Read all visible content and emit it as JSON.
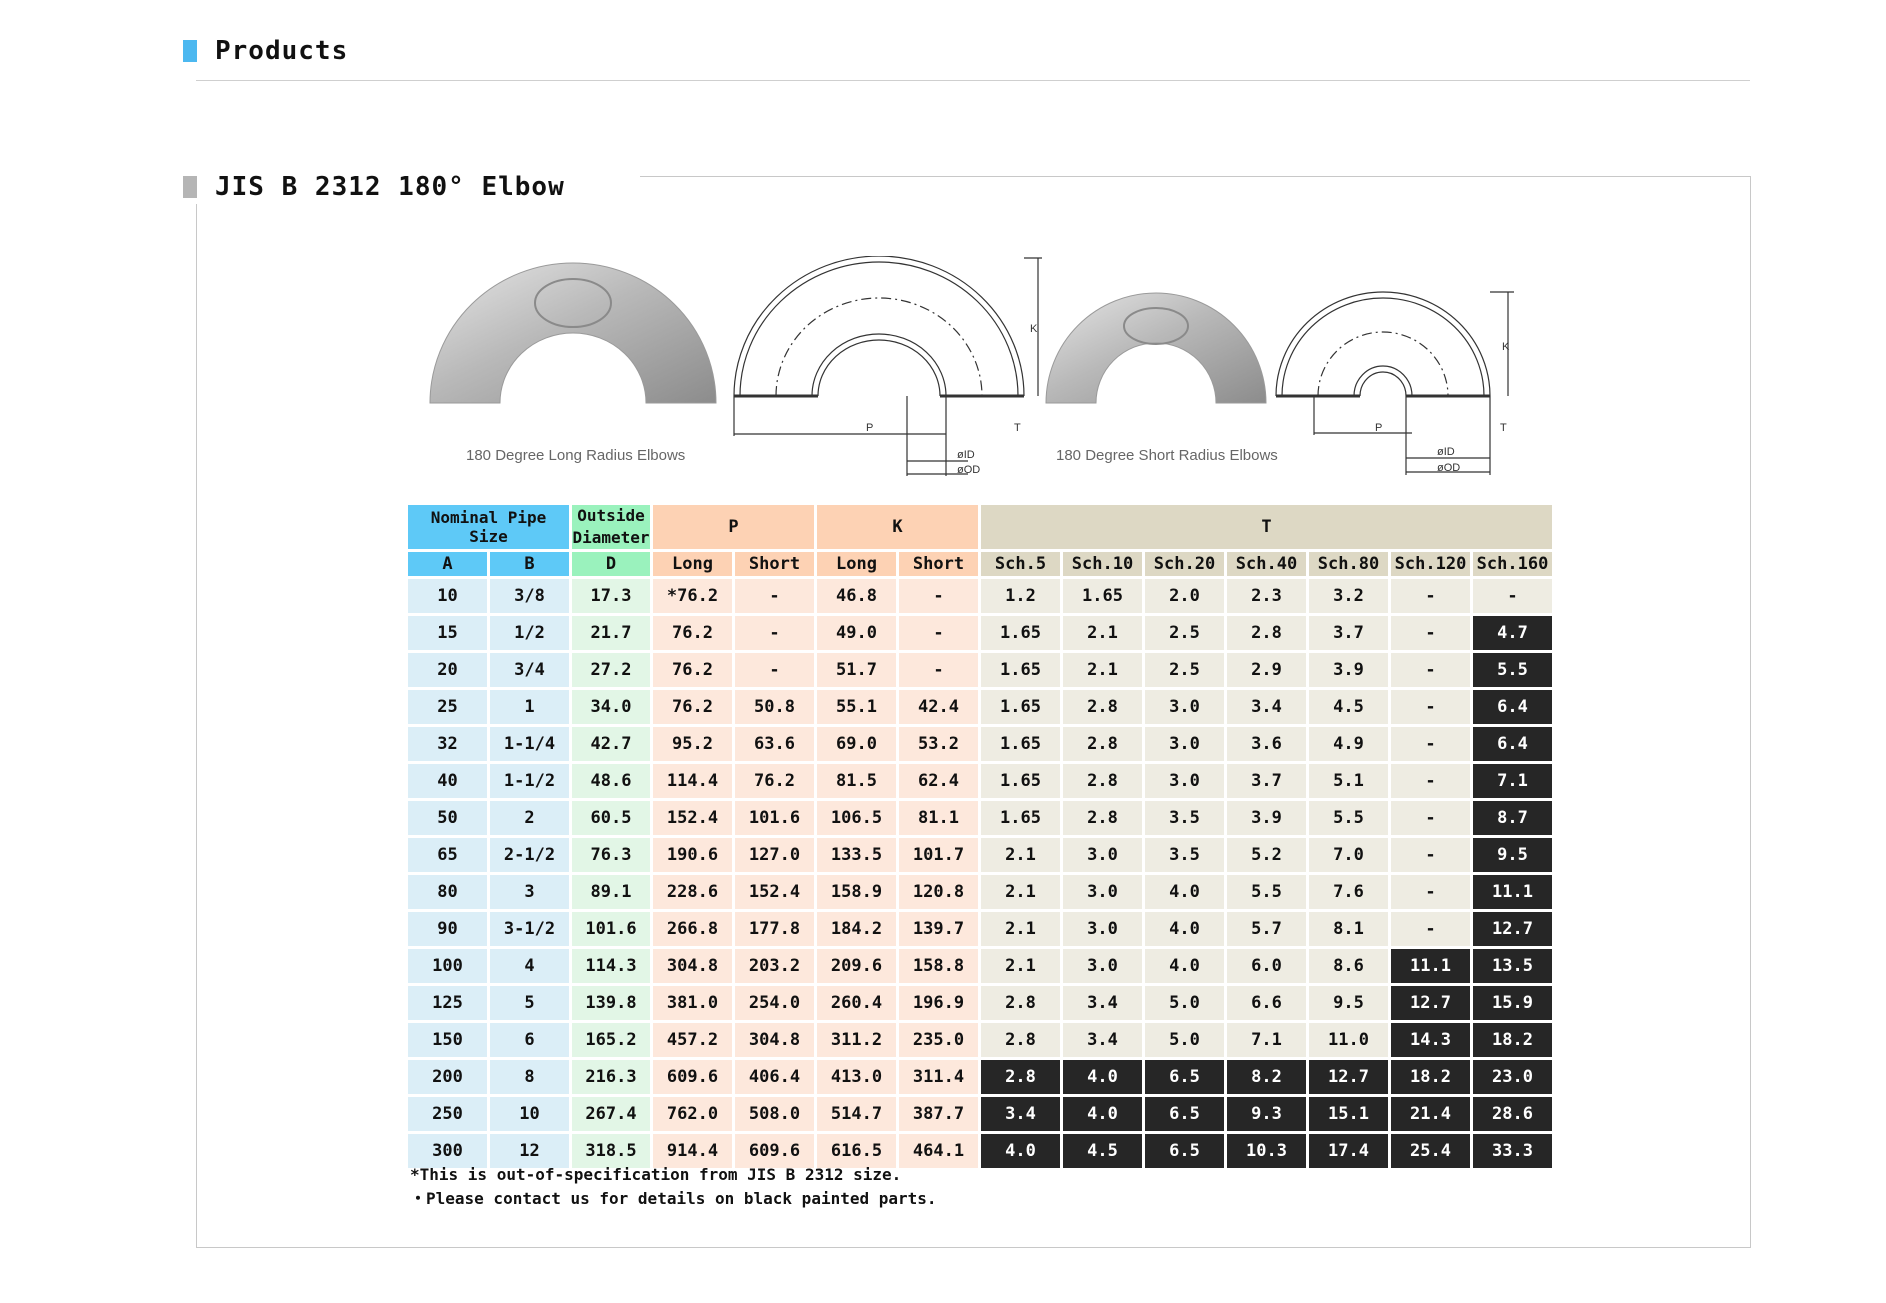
{
  "page": {
    "header": "Products",
    "section_title": "JIS B 2312 180° Elbow"
  },
  "figures": {
    "long_caption": "180 Degree Long Radius Elbows",
    "short_caption": "180 Degree Short Radius Elbows",
    "dim_p": "P",
    "dim_k": "K",
    "dim_t": "T",
    "dim_id": "øID",
    "dim_od": "øOD"
  },
  "table": {
    "h_nominal": "Nominal Pipe Size",
    "h_outside": "Outside Diameter",
    "h_p": "P",
    "h_k": "K",
    "h_t": "T",
    "sub": [
      "A",
      "B",
      "D",
      "Long",
      "Short",
      "Long",
      "Short",
      "Sch.5",
      "Sch.10",
      "Sch.20",
      "Sch.40",
      "Sch.80",
      "Sch.120",
      "Sch.160"
    ],
    "rows": [
      [
        "10",
        "3/8",
        "17.3",
        "*76.2",
        "-",
        "46.8",
        "-",
        "1.2",
        "1.65",
        "2.0",
        "2.3",
        "3.2",
        "-",
        "-"
      ],
      [
        "15",
        "1/2",
        "21.7",
        "76.2",
        "-",
        "49.0",
        "-",
        "1.65",
        "2.1",
        "2.5",
        "2.8",
        "3.7",
        "-",
        "4.7"
      ],
      [
        "20",
        "3/4",
        "27.2",
        "76.2",
        "-",
        "51.7",
        "-",
        "1.65",
        "2.1",
        "2.5",
        "2.9",
        "3.9",
        "-",
        "5.5"
      ],
      [
        "25",
        "1",
        "34.0",
        "76.2",
        "50.8",
        "55.1",
        "42.4",
        "1.65",
        "2.8",
        "3.0",
        "3.4",
        "4.5",
        "-",
        "6.4"
      ],
      [
        "32",
        "1-1/4",
        "42.7",
        "95.2",
        "63.6",
        "69.0",
        "53.2",
        "1.65",
        "2.8",
        "3.0",
        "3.6",
        "4.9",
        "-",
        "6.4"
      ],
      [
        "40",
        "1-1/2",
        "48.6",
        "114.4",
        "76.2",
        "81.5",
        "62.4",
        "1.65",
        "2.8",
        "3.0",
        "3.7",
        "5.1",
        "-",
        "7.1"
      ],
      [
        "50",
        "2",
        "60.5",
        "152.4",
        "101.6",
        "106.5",
        "81.1",
        "1.65",
        "2.8",
        "3.5",
        "3.9",
        "5.5",
        "-",
        "8.7"
      ],
      [
        "65",
        "2-1/2",
        "76.3",
        "190.6",
        "127.0",
        "133.5",
        "101.7",
        "2.1",
        "3.0",
        "3.5",
        "5.2",
        "7.0",
        "-",
        "9.5"
      ],
      [
        "80",
        "3",
        "89.1",
        "228.6",
        "152.4",
        "158.9",
        "120.8",
        "2.1",
        "3.0",
        "4.0",
        "5.5",
        "7.6",
        "-",
        "11.1"
      ],
      [
        "90",
        "3-1/2",
        "101.6",
        "266.8",
        "177.8",
        "184.2",
        "139.7",
        "2.1",
        "3.0",
        "4.0",
        "5.7",
        "8.1",
        "-",
        "12.7"
      ],
      [
        "100",
        "4",
        "114.3",
        "304.8",
        "203.2",
        "209.6",
        "158.8",
        "2.1",
        "3.0",
        "4.0",
        "6.0",
        "8.6",
        "11.1",
        "13.5"
      ],
      [
        "125",
        "5",
        "139.8",
        "381.0",
        "254.0",
        "260.4",
        "196.9",
        "2.8",
        "3.4",
        "5.0",
        "6.6",
        "9.5",
        "12.7",
        "15.9"
      ],
      [
        "150",
        "6",
        "165.2",
        "457.2",
        "304.8",
        "311.2",
        "235.0",
        "2.8",
        "3.4",
        "5.0",
        "7.1",
        "11.0",
        "14.3",
        "18.2"
      ],
      [
        "200",
        "8",
        "216.3",
        "609.6",
        "406.4",
        "413.0",
        "311.4",
        "2.8",
        "4.0",
        "6.5",
        "8.2",
        "12.7",
        "18.2",
        "23.0"
      ],
      [
        "250",
        "10",
        "267.4",
        "762.0",
        "508.0",
        "514.7",
        "387.7",
        "3.4",
        "4.0",
        "6.5",
        "9.3",
        "15.1",
        "21.4",
        "28.6"
      ],
      [
        "300",
        "12",
        "318.5",
        "914.4",
        "609.6",
        "616.5",
        "464.1",
        "4.0",
        "4.5",
        "6.5",
        "10.3",
        "17.4",
        "25.4",
        "33.3"
      ]
    ],
    "black_from": [
      99,
      13,
      13,
      13,
      13,
      13,
      13,
      13,
      13,
      13,
      12,
      12,
      12,
      7,
      7,
      7
    ]
  },
  "notes": {
    "note1": "*This is out-of-specification from JIS B 2312 size.",
    "note2": "・Please contact us for details on black painted parts."
  }
}
